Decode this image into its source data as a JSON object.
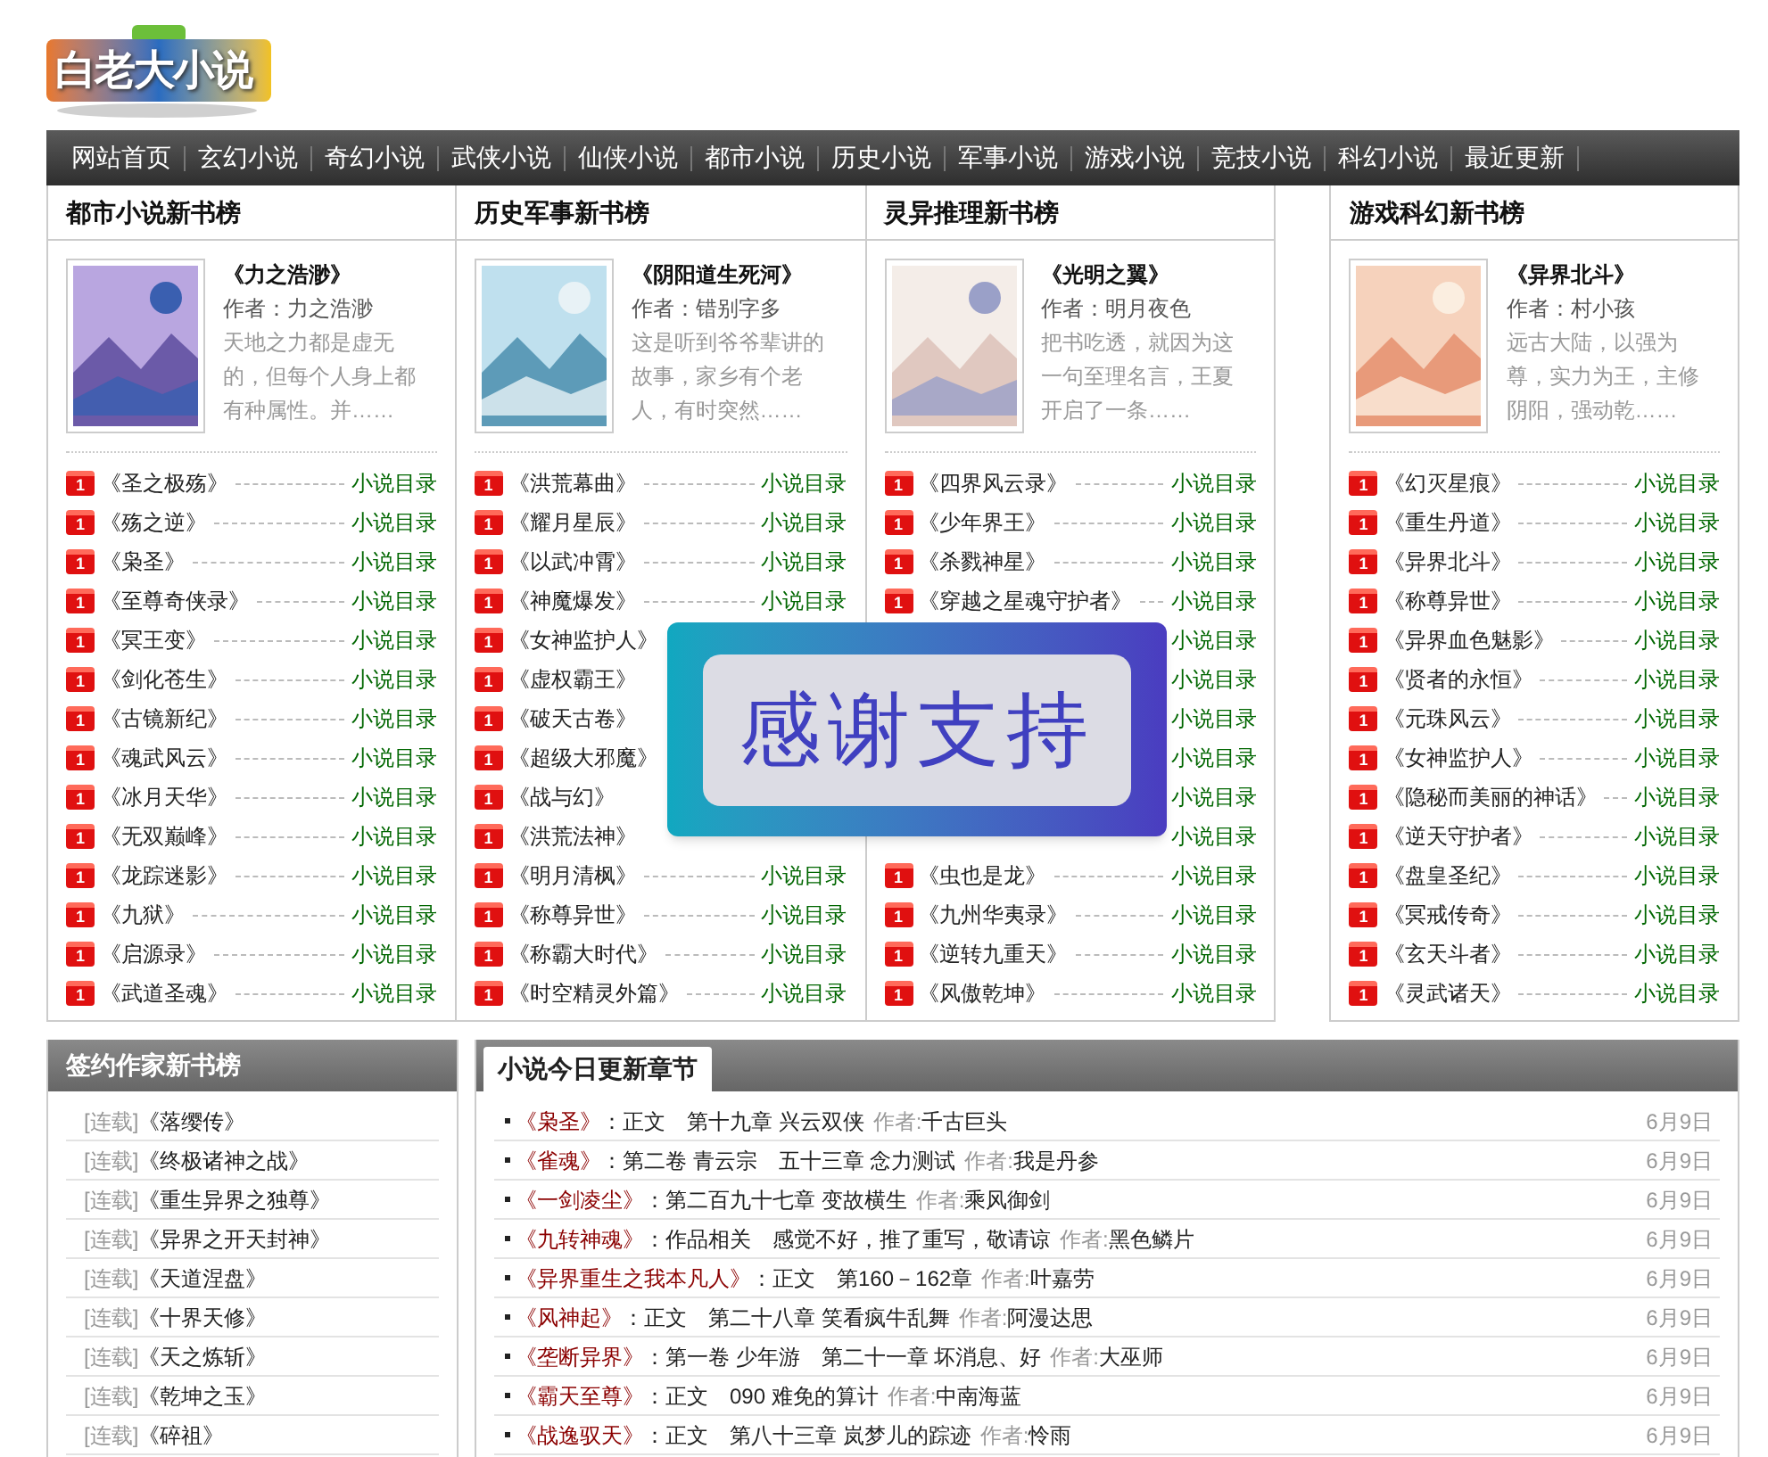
{
  "logo": {
    "text": "白老大小说"
  },
  "nav": [
    {
      "label": "网站首页"
    },
    {
      "label": "玄幻小说"
    },
    {
      "label": "奇幻小说"
    },
    {
      "label": "武侠小说"
    },
    {
      "label": "仙侠小说"
    },
    {
      "label": "都市小说"
    },
    {
      "label": "历史小说"
    },
    {
      "label": "军事小说"
    },
    {
      "label": "游戏小说"
    },
    {
      "label": "竞技小说"
    },
    {
      "label": "科幻小说"
    },
    {
      "label": "最近更新"
    }
  ],
  "rank_columns": [
    {
      "title": "都市小说新书榜",
      "featured": {
        "title": "《力之浩渺》",
        "author": "作者：力之浩渺",
        "summary": "天地之力都是虚无的，但每个人身上都有种属性。并……"
      },
      "rows": [
        {
          "badge": "1",
          "title": "《圣之极殇》",
          "link": "小说目录"
        },
        {
          "badge": "1",
          "title": "《殇之逆》",
          "link": "小说目录"
        },
        {
          "badge": "1",
          "title": "《枭圣》",
          "link": "小说目录"
        },
        {
          "badge": "1",
          "title": "《至尊奇侠录》",
          "link": "小说目录"
        },
        {
          "badge": "1",
          "title": "《冥王变》",
          "link": "小说目录"
        },
        {
          "badge": "1",
          "title": "《剑化苍生》",
          "link": "小说目录"
        },
        {
          "badge": "1",
          "title": "《古镜新纪》",
          "link": "小说目录"
        },
        {
          "badge": "1",
          "title": "《魂武风云》",
          "link": "小说目录"
        },
        {
          "badge": "1",
          "title": "《冰月天华》",
          "link": "小说目录"
        },
        {
          "badge": "1",
          "title": "《无双巅峰》",
          "link": "小说目录"
        },
        {
          "badge": "1",
          "title": "《龙踪迷影》",
          "link": "小说目录"
        },
        {
          "badge": "1",
          "title": "《九狱》",
          "link": "小说目录"
        },
        {
          "badge": "1",
          "title": "《启源录》",
          "link": "小说目录"
        },
        {
          "badge": "1",
          "title": "《武道圣魂》",
          "link": "小说目录"
        }
      ]
    },
    {
      "title": "历史军事新书榜",
      "featured": {
        "title": "《阴阳道生死河》",
        "author": "作者：错别字多",
        "summary": "这是听到爷爷辈讲的故事，家乡有个老人，有时突然……"
      },
      "rows": [
        {
          "badge": "1",
          "title": "《洪荒幕曲》",
          "link": "小说目录"
        },
        {
          "badge": "1",
          "title": "《耀月星辰》",
          "link": "小说目录"
        },
        {
          "badge": "1",
          "title": "《以武冲霄》",
          "link": "小说目录"
        },
        {
          "badge": "1",
          "title": "《神魔爆发》",
          "link": "小说目录"
        },
        {
          "badge": "1",
          "title": "《女神监护人》"
        },
        {
          "badge": "1",
          "title": "《虚权霸王》"
        },
        {
          "badge": "1",
          "title": "《破天古卷》"
        },
        {
          "badge": "1",
          "title": "《超级大邪魔》"
        },
        {
          "badge": "1",
          "title": "《战与幻》"
        },
        {
          "badge": "1",
          "title": "《洪荒法神》"
        },
        {
          "badge": "1",
          "title": "《明月清枫》",
          "link": "小说目录"
        },
        {
          "badge": "1",
          "title": "《称尊异世》",
          "link": "小说目录"
        },
        {
          "badge": "1",
          "title": "《称霸大时代》",
          "link": "小说目录"
        },
        {
          "badge": "1",
          "title": "《时空精灵外篇》",
          "link": "小说目录"
        }
      ]
    },
    {
      "title": "灵异推理新书榜",
      "featured": {
        "title": "《光明之翼》",
        "author": "作者：明月夜色",
        "summary": "把书吃透，就因为这一句至理名言，王夏开启了一条……"
      },
      "rows": [
        {
          "badge": "1",
          "title": "《四界风云录》",
          "link": "小说目录"
        },
        {
          "badge": "1",
          "title": "《少年界王》",
          "link": "小说目录"
        },
        {
          "badge": "1",
          "title": "《杀戮神星》",
          "link": "小说目录"
        },
        {
          "badge": "1",
          "title": "《穿越之星魂守护者》",
          "link": "小说目录"
        },
        {
          "link": "小说目录"
        },
        {
          "link": "小说目录"
        },
        {
          "link": "小说目录"
        },
        {
          "link": "小说目录"
        },
        {
          "link": "小说目录"
        },
        {
          "link": "小说目录"
        },
        {
          "badge": "1",
          "title": "《虫也是龙》",
          "link": "小说目录"
        },
        {
          "badge": "1",
          "title": "《九州华夷录》",
          "link": "小说目录"
        },
        {
          "badge": "1",
          "title": "《逆转九重天》",
          "link": "小说目录"
        },
        {
          "badge": "1",
          "title": "《风傲乾坤》",
          "link": "小说目录"
        }
      ]
    },
    {
      "title": "游戏科幻新书榜",
      "featured": {
        "title": "《异界北斗》",
        "author": "作者：村小孩",
        "summary": "远古大陆，以强为尊，实力为王，主修阴阳，强动乾……"
      },
      "rows": [
        {
          "badge": "1",
          "title": "《幻灭星痕》",
          "link": "小说目录"
        },
        {
          "badge": "1",
          "title": "《重生丹道》",
          "link": "小说目录"
        },
        {
          "badge": "1",
          "title": "《异界北斗》",
          "link": "小说目录"
        },
        {
          "badge": "1",
          "title": "《称尊异世》",
          "link": "小说目录"
        },
        {
          "badge": "1",
          "title": "《异界血色魅影》",
          "link": "小说目录"
        },
        {
          "badge": "1",
          "title": "《贤者的永恒》",
          "link": "小说目录"
        },
        {
          "badge": "1",
          "title": "《元珠风云》",
          "link": "小说目录"
        },
        {
          "badge": "1",
          "title": "《女神监护人》",
          "link": "小说目录"
        },
        {
          "badge": "1",
          "title": "《隐秘而美丽的神话》",
          "link": "小说目录"
        },
        {
          "badge": "1",
          "title": "《逆天守护者》",
          "link": "小说目录"
        },
        {
          "badge": "1",
          "title": "《盘皇圣纪》",
          "link": "小说目录"
        },
        {
          "badge": "1",
          "title": "《冥戒传奇》",
          "link": "小说目录"
        },
        {
          "badge": "1",
          "title": "《玄天斗者》",
          "link": "小说目录"
        },
        {
          "badge": "1",
          "title": "《灵武诸天》",
          "link": "小说目录"
        }
      ]
    }
  ],
  "overlay": {
    "text": "感谢支持"
  },
  "signed_list": {
    "title": "签约作家新书榜",
    "rows": [
      {
        "tag": "[连载]",
        "title": "《落缨传》"
      },
      {
        "tag": "[连载]",
        "title": "《终极诸神之战》"
      },
      {
        "tag": "[连载]",
        "title": "《重生异界之独尊》"
      },
      {
        "tag": "[连载]",
        "title": "《异界之开天封神》"
      },
      {
        "tag": "[连载]",
        "title": "《天道涅盘》"
      },
      {
        "tag": "[连载]",
        "title": "《十界天修》"
      },
      {
        "tag": "[连载]",
        "title": "《天之炼斩》"
      },
      {
        "tag": "[连载]",
        "title": "《乾坤之玉》"
      },
      {
        "tag": "[连载]",
        "title": "《碎祖》"
      }
    ]
  },
  "updates": {
    "tab": "小说今日更新章节",
    "rows": [
      {
        "title": "《枭圣》",
        "chapter": "：正文　第十九章 兴云双侠",
        "author_label": "作者:",
        "author": "千古巨头",
        "date": "6月9日"
      },
      {
        "title": "《雀魂》",
        "chapter": "：第二卷 青云宗　五十三章 念力测试",
        "author_label": "作者:",
        "author": "我是丹参",
        "date": "6月9日"
      },
      {
        "title": "《一剑凌尘》",
        "chapter": "：第二百九十七章 变故横生",
        "author_label": "作者:",
        "author": "乘风御剑",
        "date": "6月9日"
      },
      {
        "title": "《九转神魂》",
        "chapter": "：作品相关　感觉不好，推了重写，敬请谅",
        "author_label": "作者:",
        "author": "黑色鳞片",
        "date": "6月9日"
      },
      {
        "title": "《异界重生之我本凡人》",
        "chapter": "：正文　第160－162章",
        "author_label": "作者:",
        "author": "叶嘉劳",
        "date": "6月9日"
      },
      {
        "title": "《风神起》",
        "chapter": "：正文　第二十八章 笑看疯牛乱舞",
        "author_label": "作者:",
        "author": "阿漫达思",
        "date": "6月9日"
      },
      {
        "title": "《垄断异界》",
        "chapter": "：第一卷 少年游　第二十一章 坏消息、好",
        "author_label": "作者:",
        "author": "大巫师",
        "date": "6月9日"
      },
      {
        "title": "《霸天至尊》",
        "chapter": "：正文　090 难免的算计",
        "author_label": "作者:",
        "author": "中南海蓝",
        "date": "6月9日"
      },
      {
        "title": "《战逸驭天》",
        "chapter": "：正文　第八十三章 岚梦儿的踪迹",
        "author_label": "作者:",
        "author": "怜雨",
        "date": "6月9日"
      }
    ]
  }
}
